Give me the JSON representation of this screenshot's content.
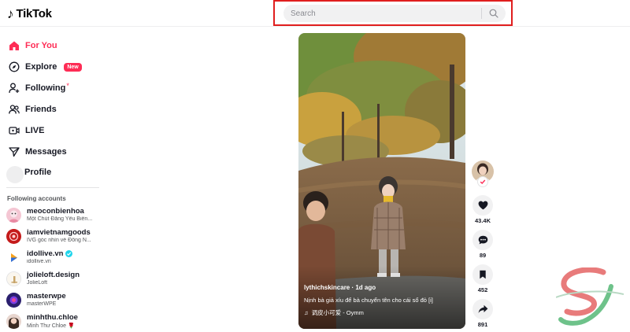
{
  "app": {
    "logo_text": "TikTok"
  },
  "search": {
    "placeholder": "Search"
  },
  "nav": [
    {
      "label": "For You",
      "icon": "home-icon",
      "active": true
    },
    {
      "label": "Explore",
      "icon": "compass-icon",
      "badge": "New"
    },
    {
      "label": "Following",
      "icon": "add-user-icon",
      "dot": "*"
    },
    {
      "label": "Friends",
      "icon": "friends-icon"
    },
    {
      "label": "LIVE",
      "icon": "live-icon"
    },
    {
      "label": "Messages",
      "icon": "paper-plane-icon"
    }
  ],
  "profile": {
    "label": "Profile"
  },
  "following": {
    "title": "Following accounts",
    "accounts": [
      {
        "name": "meoconbienhoa",
        "sub": "Một Chút Đăng Yêu Biển...",
        "verified": false
      },
      {
        "name": "iamvietnamgoods",
        "sub": "IVG góc nhìn về Đông N...",
        "verified": false
      },
      {
        "name": "idollive.vn",
        "sub": "idollive.vn",
        "verified": true
      },
      {
        "name": "jolieloft.design",
        "sub": "JolieLoft",
        "verified": false
      },
      {
        "name": "masterwpe",
        "sub": "masterWPE",
        "verified": false
      },
      {
        "name": "minhthu.chloe",
        "sub": "Minh Thư Chloe 🌹",
        "verified": false
      }
    ]
  },
  "video": {
    "author_line": "lythichskincare · 1d ago",
    "caption": "Nịnh bà giả xíu để bà chuyển tên cho cái sổ đỏ [i]",
    "music": "调皮小可爱 - Oymm"
  },
  "actions": {
    "likes": "43.4K",
    "comments": "89",
    "saves": "452",
    "shares": "891"
  },
  "colors": {
    "accent": "#fe2c55",
    "search_highlight": "#e01e1e"
  }
}
